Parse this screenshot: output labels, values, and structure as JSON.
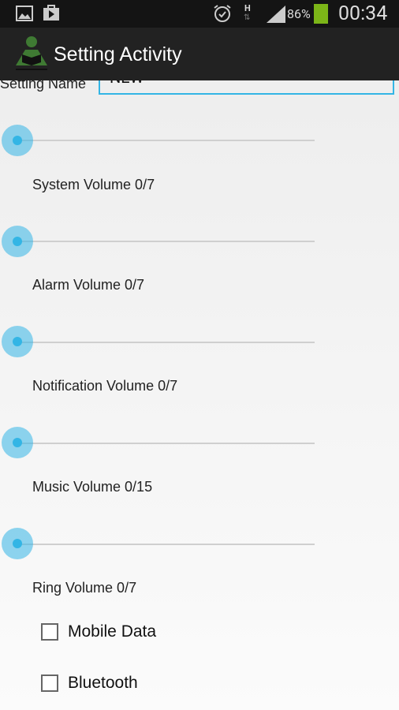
{
  "status_bar": {
    "battery": "86%",
    "time": "00:34",
    "network": "H",
    "icons": [
      "gallery-icon",
      "play-store-icon",
      "alarm-icon",
      "data-arrows-icon",
      "signal-icon",
      "battery-icon"
    ],
    "battery_color": "#7cb518"
  },
  "app_bar": {
    "title": "Setting Activity",
    "icon": "reading-person-icon",
    "icon_color": "#3f7a33"
  },
  "form": {
    "setting_name_label": "Setting Name",
    "setting_name_value": "NEW"
  },
  "sliders": [
    {
      "label": "System Volume 0/7",
      "value": 0,
      "max": 7
    },
    {
      "label": "Alarm Volume 0/7",
      "value": 0,
      "max": 7
    },
    {
      "label": "Notification Volume 0/7",
      "value": 0,
      "max": 7
    },
    {
      "label": "Music Volume 0/15",
      "value": 0,
      "max": 15
    },
    {
      "label": "Ring Volume 0/7",
      "value": 0,
      "max": 7
    }
  ],
  "checkboxes": [
    {
      "label": "Mobile Data",
      "checked": false
    },
    {
      "label": "Bluetooth",
      "checked": false
    }
  ],
  "accent": "#33b5e5"
}
